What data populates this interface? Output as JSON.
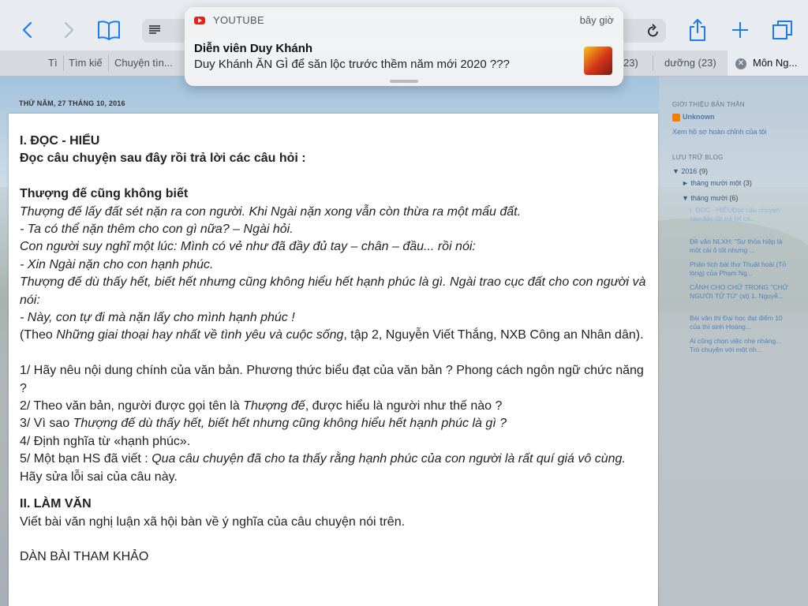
{
  "toolbar": {
    "back_icon": "chevron-left",
    "forward_icon": "chevron-right",
    "bookmarks_icon": "book",
    "reader_icon": "reader-lines",
    "reload_icon": "reload",
    "share_icon": "share",
    "new_tab_icon": "plus",
    "tabs_icon": "tabs-overview",
    "accent": "#1a7cf5"
  },
  "tabs": [
    {
      "label": "Tì"
    },
    {
      "label": "Tìm kiế"
    },
    {
      "label": "Chuyện tìn..."
    },
    {
      "label": "23)"
    },
    {
      "label": "dưỡng (23)"
    },
    {
      "label": "Môn Ng..."
    }
  ],
  "notification": {
    "app": "YOUTUBE",
    "time": "bây giờ",
    "title": "Diễn viên Duy Khánh",
    "body": "Duy Khánh ĂN GÌ để săn lộc trước thềm năm mới 2020 ???"
  },
  "post": {
    "date": "THỨ NĂM, 27 THÁNG 10, 2016",
    "section1": "I. ĐỌC - HIỂU",
    "instruction": "Đọc câu chuyện sau đây rồi trả lời các câu hỏi :",
    "story_title": "Thượng đế cũng không biết",
    "story_lines": [
      "Thượng đế lấy đất sét nặn ra con người. Khi Ngài nặn xong vẫn còn thừa ra một mẩu đất.",
      "- Ta có thể nặn thêm cho con gì nữa? – Ngài hỏi.",
      "Con người suy nghĩ một lúc: Mình có vẻ như đã đầy đủ tay – chân – đầu... rồi nói:",
      "- Xin Ngài nặn cho con hạnh phúc.",
      "Thượng đế dù thấy hết, biết hết nhưng cũng không hiểu hết hạnh phúc là gì. Ngài trao cục đất cho con người và nói:",
      "- Này, con tự đi mà nặn lấy cho mình hạnh phúc !"
    ],
    "source_pre": "(Theo ",
    "source_book": "Những giai thoại hay nhất về tình yêu và cuộc sống",
    "source_post": ", tập 2, Nguyễn Viết Thắng, NXB Công an Nhân dân).",
    "q1": "1/  Hãy nêu nội dung chính của văn bản. Phương thức biểu đạt của văn bản ? Phong cách ngôn ngữ chức năng ?",
    "q2_pre": "2/  Theo văn bản, người được gọi tên là ",
    "q2_em": "Thượng đế",
    "q2_post": ", được hiểu là người như thế nào ?",
    "q3_pre": " 3/  Vì sao ",
    "q3_em": "Thượng đế dù thấy hết, biết hết nhưng cũng không hiểu hết hạnh phúc là gì ?",
    "q4": " 4/ Định nghĩa từ «hạnh phúc».",
    "q5_pre": " 5/ Một bạn HS đã viết : ",
    "q5_em": "Qua câu chuyện đã cho ta thấy rằng hạnh phúc của con người là rất quí giá vô cùng.",
    "q5_post": " Hãy sửa lỗi sai của câu này.",
    "section2": "II. LÀM VĂN",
    "task": "Viết bài văn nghị luận xã hội bàn về ý nghĩa của câu chuyện nói trên.",
    "outline": "DÀN BÀI THAM KHẢO"
  },
  "sidebar": {
    "about_heading": "GIỚI THIỆU BẢN THÂN",
    "author": "Unknown",
    "profile_link": "Xem hồ sơ hoàn chỉnh của tôi",
    "archive_heading": "LƯU TRỮ BLOG",
    "year": "▼ 2016",
    "year_count": "(9)",
    "month1": "► tháng mười một",
    "month1_count": "(3)",
    "month2": "▼ tháng mười",
    "month2_count": "(6)",
    "posts": [
      "I. ĐỌC - HIỂUĐọc câu chuyện sau đây rồi trả lời cá...",
      "Đề văn NLXH: \"Sự thỏa hiệp là một cái ô tốt nhưng ...",
      "Phân tích bài thơ Thuật hoài (Tỏ lòng) của Phạm Ng...",
      "CẢNH CHO CHỮ TRONG \"CHỮ NGƯỜI TỬ TÙ\" (st) 1. Nguyễ...",
      "Bài văn thi Đại học đạt điểm 10 của thí sinh Hoàng...",
      "Ai cũng chọn việc nhẹ nhàng... Trò chuyện với một nh..."
    ]
  }
}
